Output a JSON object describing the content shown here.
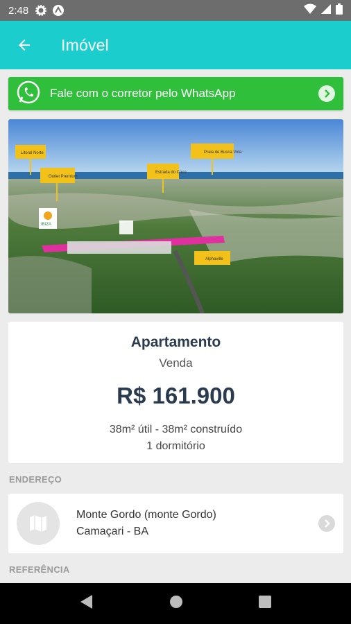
{
  "status_bar": {
    "time": "2:48",
    "icons": [
      "settings-icon",
      "app-notification-icon",
      "wifi-icon",
      "signal-icon",
      "battery-icon"
    ]
  },
  "app_bar": {
    "title": "Imóvel",
    "back_icon": "arrow-left-icon",
    "color": "#1ccdcd"
  },
  "whatsapp": {
    "label": "Fale com o corretor pelo WhatsApp",
    "icon": "whatsapp-icon",
    "color": "#2fbf3a"
  },
  "photo": {
    "description_tags": [
      "Litoral Norte",
      "Outlet Premium",
      "Estrada do Coco",
      "Praia de Busca Vida",
      "Alphaville",
      "IBIZA"
    ]
  },
  "listing": {
    "type": "Apartamento",
    "deal": "Venda",
    "price": "R$ 161.900",
    "area": "38m² útil - 38m² construído",
    "rooms": "1 dormitório"
  },
  "address": {
    "section_label": "ENDEREÇO",
    "line1": "Monte Gordo (monte Gordo)",
    "line2": "Camaçari - BA",
    "icon": "map-icon"
  },
  "reference": {
    "section_label": "REFERÊNCIA"
  },
  "nav": {
    "icons": [
      "back-triangle-icon",
      "home-circle-icon",
      "recents-square-icon"
    ]
  }
}
